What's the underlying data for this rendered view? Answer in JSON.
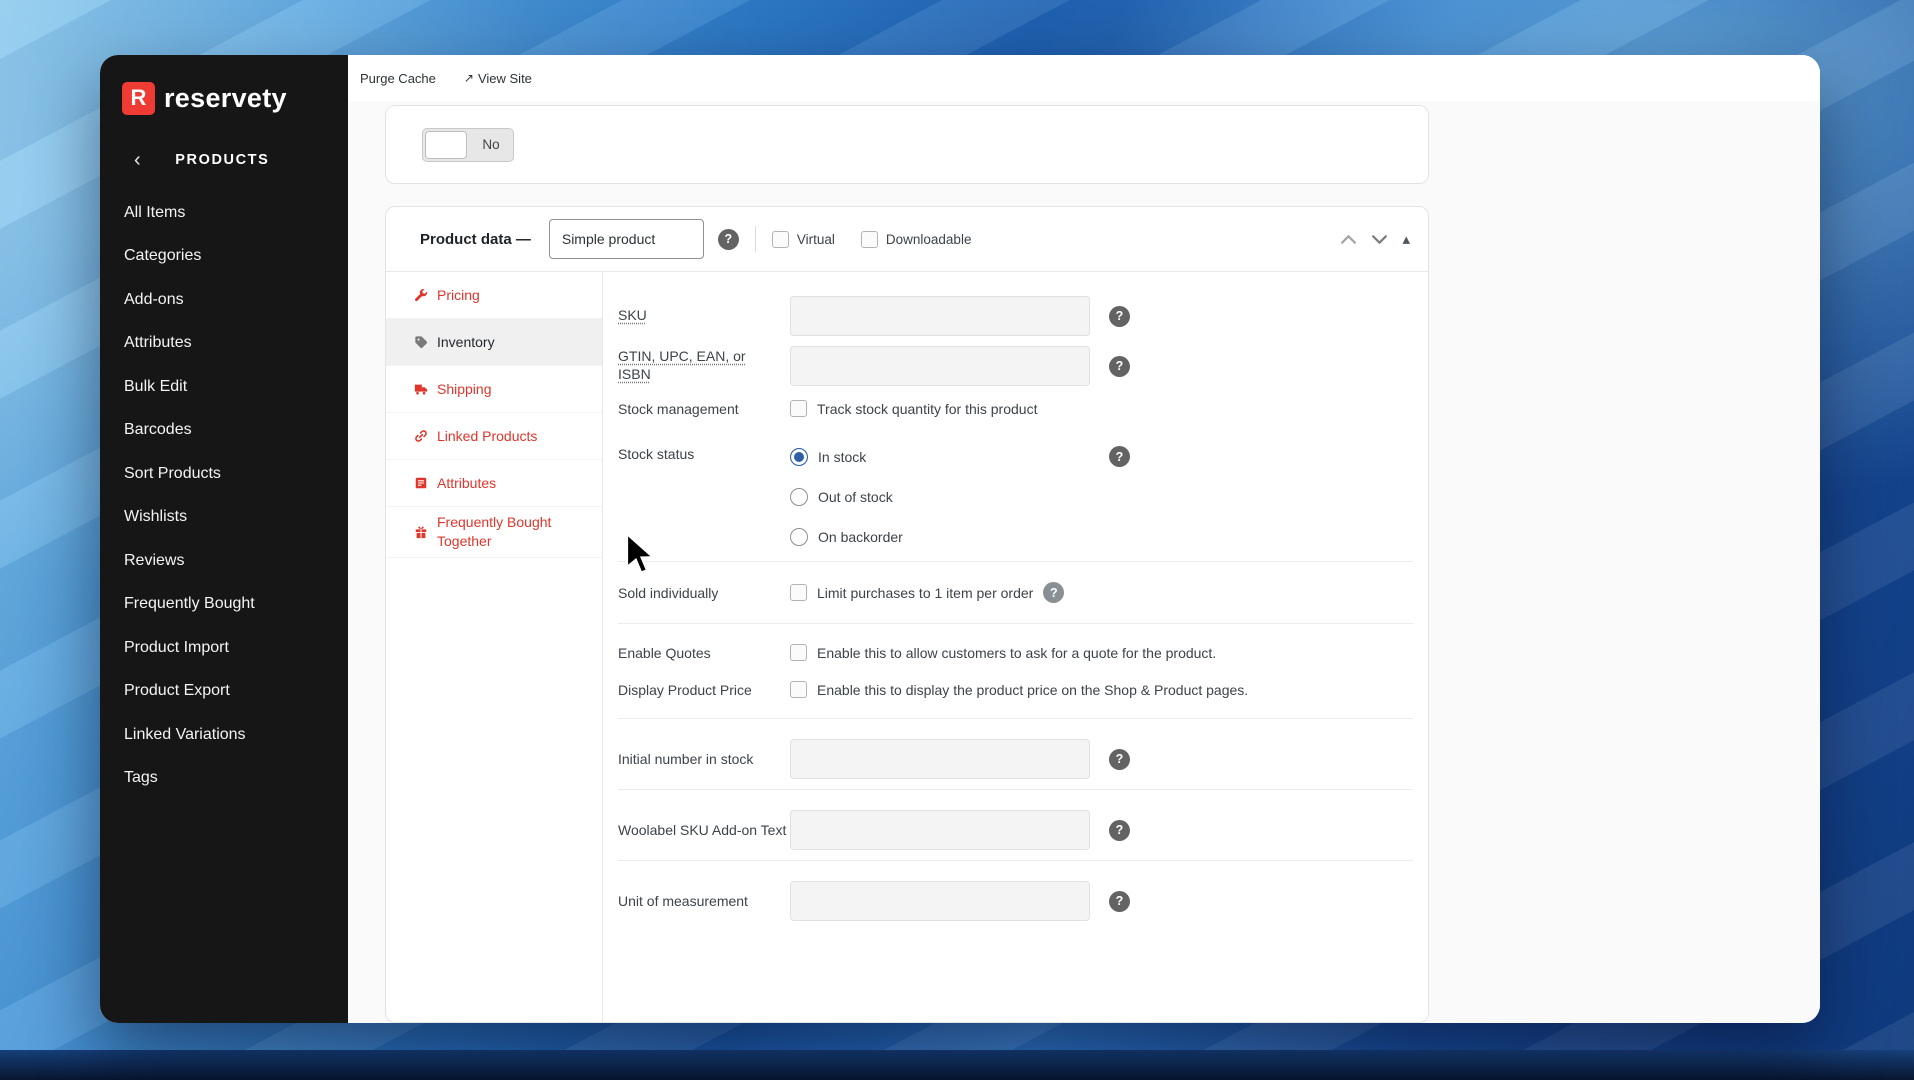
{
  "icons": {
    "question": "?",
    "chevron_left": "‹",
    "external": "↗",
    "triangle_up": "▴"
  },
  "topbar": {
    "purge_cache": "Purge Cache",
    "view_site": "View Site"
  },
  "sidebar": {
    "brand": "reservety",
    "brand_initial": "R",
    "section": "PRODUCTS",
    "items": [
      "All Items",
      "Categories",
      "Add-ons",
      "Attributes",
      "Bulk Edit",
      "Barcodes",
      "Sort Products",
      "Wishlists",
      "Reviews",
      "Frequently Bought",
      "Product Import",
      "Product Export",
      "Linked Variations",
      "Tags"
    ]
  },
  "top_card": {
    "toggle_label": "No"
  },
  "panel": {
    "title": "Product data —",
    "product_type": "Simple product",
    "virtual_label": "Virtual",
    "downloadable_label": "Downloadable",
    "tabs": [
      {
        "label": "Pricing"
      },
      {
        "label": "Inventory"
      },
      {
        "label": "Shipping"
      },
      {
        "label": "Linked Products"
      },
      {
        "label": "Attributes"
      },
      {
        "label": "Frequently Bought Together"
      }
    ],
    "form": {
      "sku_label": "SKU",
      "gtin_label": "GTIN, UPC, EAN, or ISBN",
      "stock_mgmt_label": "Stock management",
      "stock_mgmt_checkbox": "Track stock quantity for this product",
      "stock_status_label": "Stock status",
      "stock_status_options": [
        "In stock",
        "Out of stock",
        "On backorder"
      ],
      "sold_individually_label": "Sold individually",
      "sold_individually_checkbox": "Limit purchases to 1 item per order",
      "enable_quotes_label": "Enable Quotes",
      "enable_quotes_checkbox": "Enable this to allow customers to ask for a quote for the product.",
      "display_price_label": "Display Product Price",
      "display_price_checkbox": "Enable this to display the product price on the Shop & Product pages.",
      "initial_stock_label": "Initial number in stock",
      "woolabel_label": "Woolabel SKU Add-on Text",
      "unit_label": "Unit of measurement"
    }
  },
  "colors": {
    "brand_red": "#ee3b33",
    "tab_red": "#e0352b",
    "radio_blue": "#2d5fa8",
    "sidebar_bg": "#161616"
  }
}
